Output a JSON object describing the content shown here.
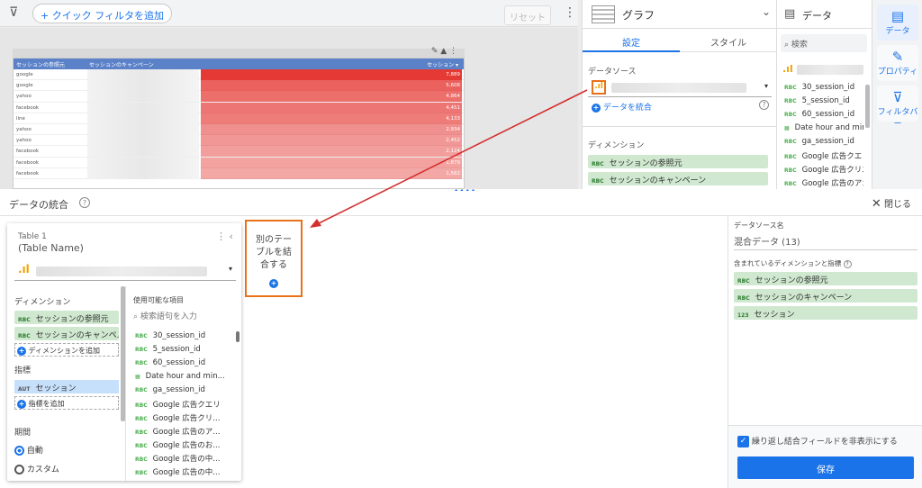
{
  "toolbar": {
    "filter_icon": "filter-icon",
    "chip_label": "+ クイック フィルタを追加",
    "reset_label": "リセット",
    "more_icon": "more-vert-icon"
  },
  "report_table": {
    "headers": [
      "セッションの参照元",
      "セッションのキャンペーン",
      "セッション ▾"
    ],
    "rows": [
      {
        "source": "google",
        "value": "7,889",
        "level": 1.0
      },
      {
        "source": "google",
        "value": "5,608",
        "level": 0.72
      },
      {
        "source": "yahoo",
        "value": "4,864",
        "level": 0.62
      },
      {
        "source": "facebook",
        "value": "4,451",
        "level": 0.56
      },
      {
        "source": "line",
        "value": "4,133",
        "level": 0.52
      },
      {
        "source": "yahoo",
        "value": "2,934",
        "level": 0.37
      },
      {
        "source": "yahoo",
        "value": "2,452",
        "level": 0.31
      },
      {
        "source": "facebook",
        "value": "2,124",
        "level": 0.27
      },
      {
        "source": "facebook",
        "value": "1,879",
        "level": 0.24
      },
      {
        "source": "facebook",
        "value": "1,562",
        "level": 0.2
      }
    ],
    "bar_color": "#e53935"
  },
  "chart_panel": {
    "chart_type_label": "グラフ",
    "tab_setup": "設定",
    "tab_style": "スタイル",
    "datasource_label": "データソース",
    "blend_link": "データを統合",
    "dimension_label": "ディメンション",
    "dimensions": [
      "セッションの参照元",
      "セッションのキャンペーン"
    ]
  },
  "data_panel": {
    "title": "データ",
    "search_placeholder": "検索",
    "fields": [
      "30_session_id",
      "5_session_id",
      "60_session_id",
      "Date hour and minute",
      "ga_session_id",
      "Google 広告クエリ",
      "Google 広告クリエ...",
      "Google 広告のアカ..."
    ]
  },
  "rail": {
    "data_label": "データ",
    "props_label": "プロパティ",
    "filter_label": "フィルタバー"
  },
  "blend": {
    "title": "データの統合",
    "help": "?",
    "close_label": "閉じる",
    "table_label": "Table 1",
    "table_name": "(Table Name)",
    "dimension_label": "ディメンション",
    "dimensions": [
      "セッションの参照元",
      "セッションのキャンペ..."
    ],
    "add_dimension": "ディメンションを追加",
    "metric_label": "指標",
    "metrics": [
      "セッション"
    ],
    "metric_type": "AUT",
    "add_metric": "指標を追加",
    "period_label": "期間",
    "period_auto": "自動",
    "period_custom": "カスタム",
    "available_label": "使用可能な項目",
    "search_placeholder": "検索語句を入力",
    "available_fields": [
      "30_session_id",
      "5_session_id",
      "60_session_id",
      "Date hour and min...",
      "ga_session_id",
      "Google 広告クエリ",
      "Google 広告クリ...",
      "Google 広告のア...",
      "Google 広告のお...",
      "Google 広告の中...",
      "Google 広告の中..."
    ],
    "join_label": "別のテーブルを結合する"
  },
  "right_sidebar": {
    "datasource_name_label": "データソース名",
    "datasource_name": "混合データ (13)",
    "included_label": "含まれているディメンションと指標",
    "included": [
      {
        "type": "ABC",
        "label": "セッションの参照元"
      },
      {
        "type": "ABC",
        "label": "セッションのキャンペーン"
      },
      {
        "type": "123",
        "label": "セッション"
      }
    ],
    "checkbox_label": "繰り返し結合フィールドを非表示にする",
    "save_label": "保存"
  },
  "accent": "#1a73e8",
  "annotation_color": "#e8711a"
}
